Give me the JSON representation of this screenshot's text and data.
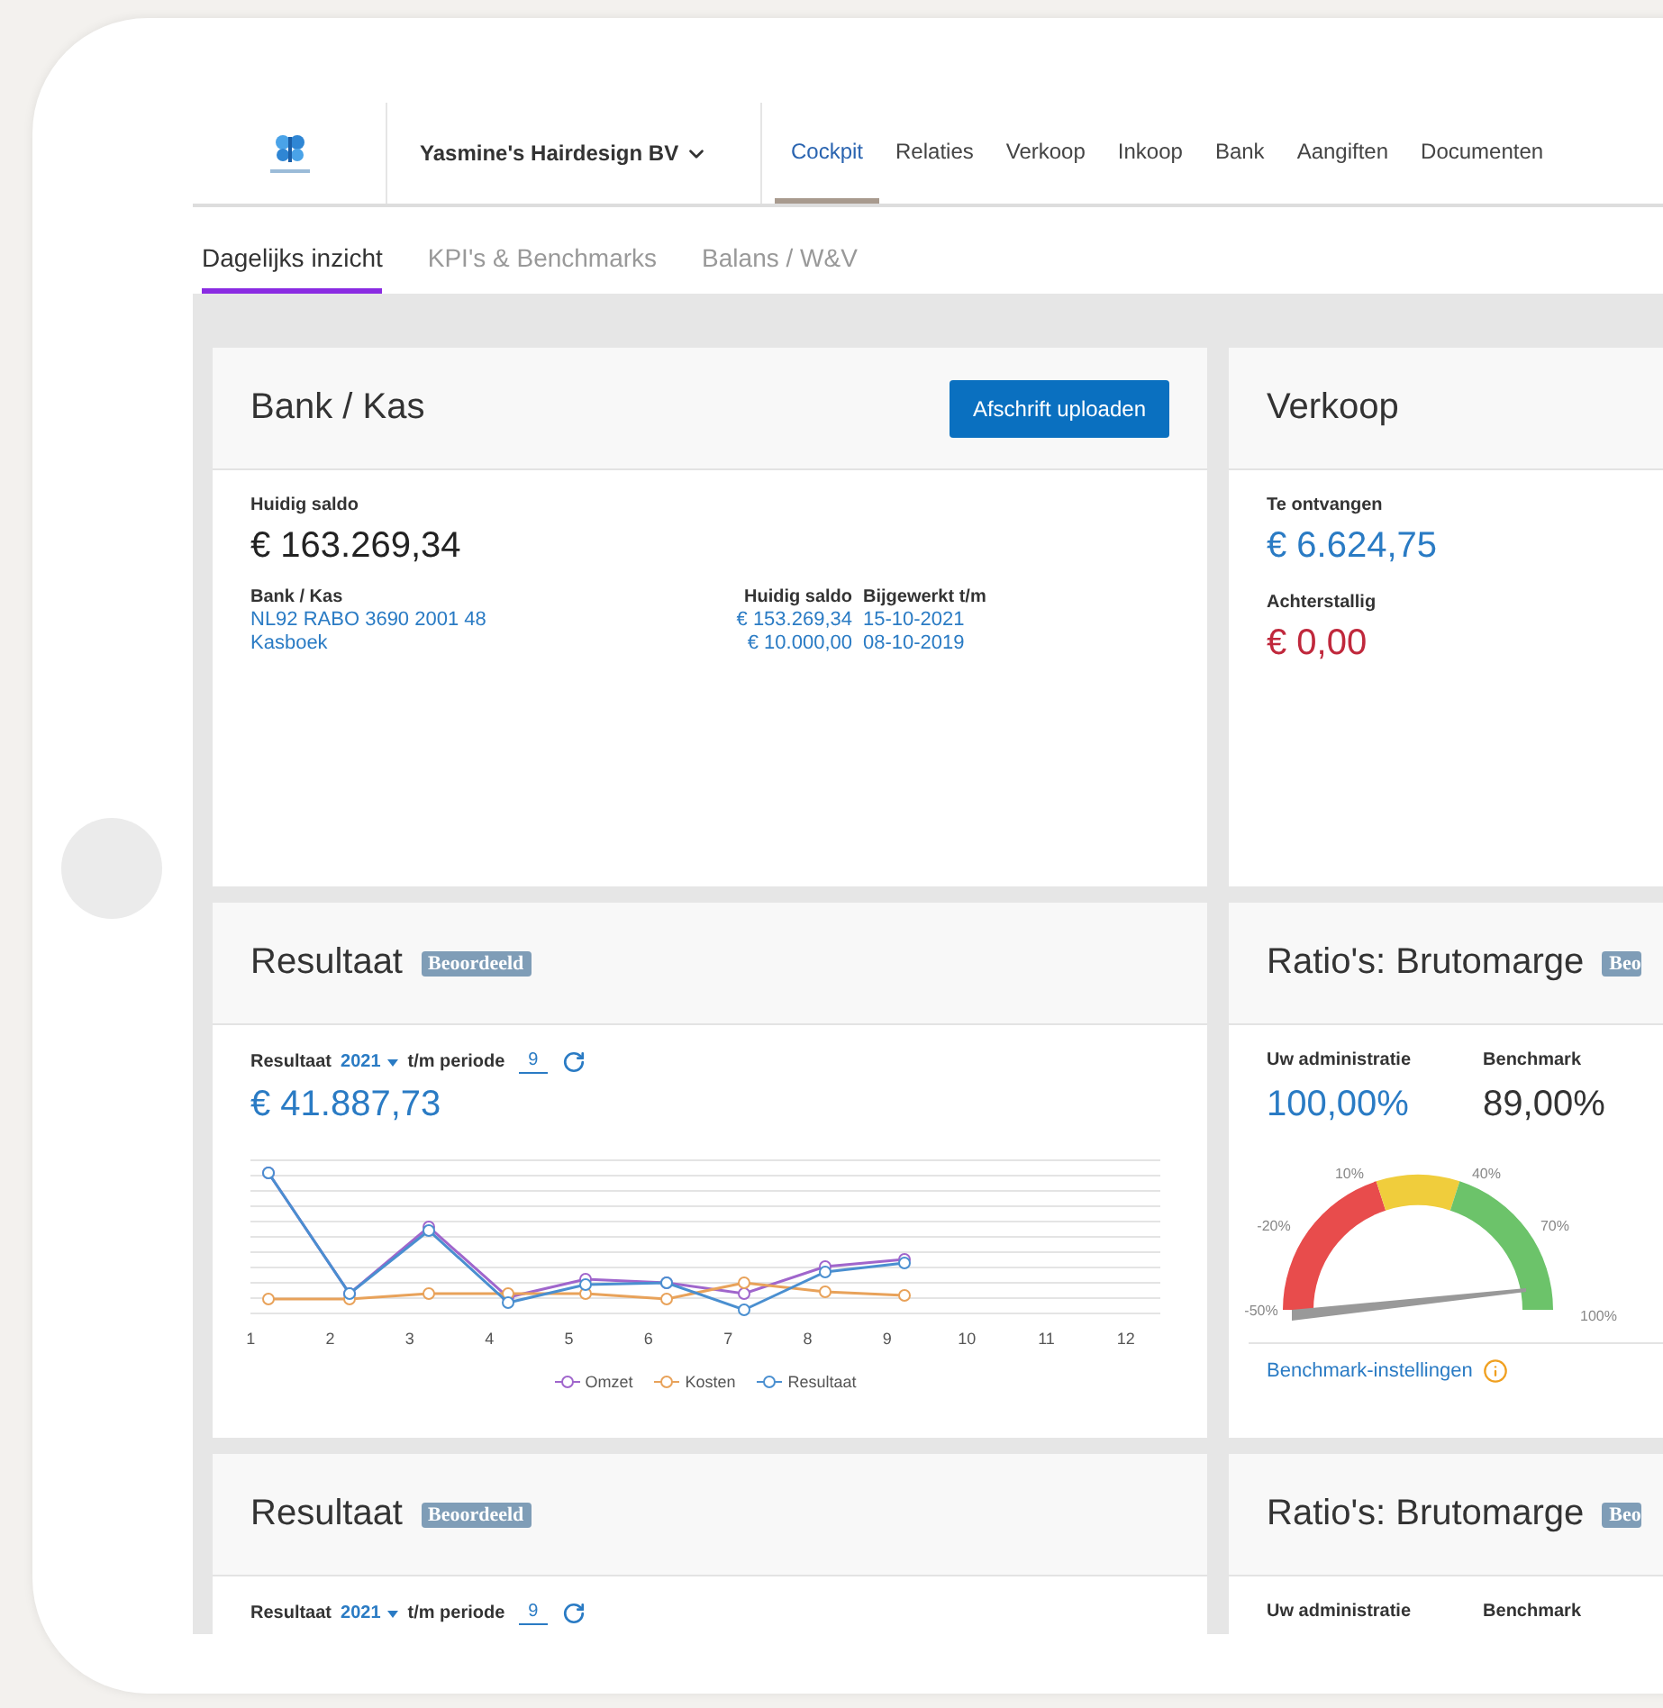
{
  "company": {
    "name": "Yasmine's Hairdesign BV"
  },
  "nav_tabs": [
    {
      "label": "Cockpit",
      "selected": true
    },
    {
      "label": "Relaties",
      "selected": false
    },
    {
      "label": "Verkoop",
      "selected": false
    },
    {
      "label": "Inkoop",
      "selected": false
    },
    {
      "label": "Bank",
      "selected": false
    },
    {
      "label": "Aangiften",
      "selected": false
    },
    {
      "label": "Documenten",
      "selected": false
    }
  ],
  "sub_tabs": [
    {
      "label": "Dagelijks inzicht",
      "selected": true
    },
    {
      "label": "KPI's & Benchmarks",
      "selected": false
    },
    {
      "label": "Balans / W&V",
      "selected": false
    }
  ],
  "cards": [
    {
      "kind": "bank",
      "title": "Bank / Kas",
      "button": "Afschrift uploaden",
      "balance_label": "Huidig saldo",
      "balance": "€ 163.269,34",
      "columns": [
        "Bank / Kas",
        "Huidig saldo",
        "Bijgewerkt t/m"
      ],
      "accounts": [
        {
          "name": "NL92 RABO 3690 2001 48",
          "balance": "€ 153.269,34",
          "updated": "15-10-2021"
        },
        {
          "name": "Kasboek",
          "balance": "€ 10.000,00",
          "updated": "08-10-2019"
        }
      ]
    },
    {
      "kind": "sales",
      "title": "Verkoop",
      "items": [
        {
          "label": "Te ontvangen",
          "value": "€ 6.624,75",
          "overdue": false
        },
        {
          "label": "Achterstallig",
          "value": "€ 0,00",
          "overdue": true
        }
      ]
    },
    {
      "kind": "result",
      "title": "Resultaat",
      "badge": "Beoordeeld",
      "filter": {
        "label": "Resultaat",
        "year": "2021",
        "period_label": "t/m periode",
        "period": "9"
      },
      "total": "€ 41.887,73",
      "chart": {
        "x_labels": [
          "1",
          "2",
          "3",
          "4",
          "5",
          "6",
          "7",
          "8",
          "9",
          "10",
          "11",
          "12"
        ],
        "legend": [
          {
            "name": "Omzet",
            "color": "#a066cc"
          },
          {
            "name": "Kosten",
            "color": "#e8a25a"
          },
          {
            "name": "Resultaat",
            "color": "#4a8fd0"
          }
        ]
      }
    },
    {
      "kind": "ratio",
      "title": "Ratio's: Brutomarge",
      "badge": "Beo",
      "own_label": "Uw administratie",
      "own_value": "100,00%",
      "bench_label": "Benchmark",
      "bench_value": "89,00%",
      "gauge_labels": [
        "-50%",
        "-20%",
        "10%",
        "40%",
        "70%",
        "100%"
      ],
      "link": "Benchmark-instellingen"
    },
    {
      "kind": "result",
      "title": "Resultaat",
      "badge": "Beoordeeld",
      "filter": {
        "label": "Resultaat",
        "year": "2021",
        "period_label": "t/m periode",
        "period": "9"
      }
    },
    {
      "kind": "ratio",
      "title": "Ratio's: Brutomarge",
      "badge": "Beo",
      "own_label": "Uw administratie",
      "bench_label": "Benchmark"
    }
  ]
}
